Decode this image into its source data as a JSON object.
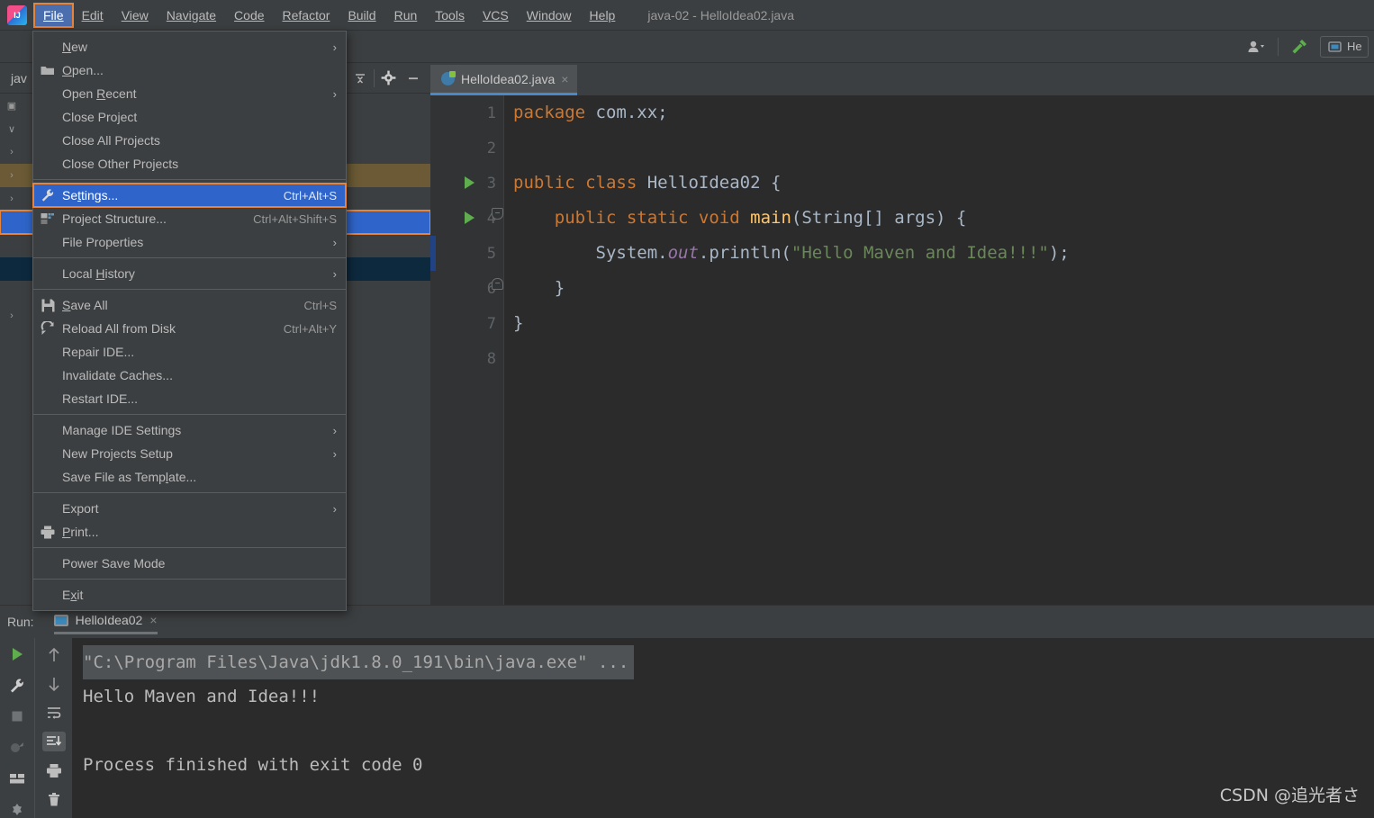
{
  "window": {
    "title": "java-02 - HelloIdea02.java"
  },
  "menubar": {
    "items": [
      {
        "label": "File",
        "mnemonic": "F",
        "active": true
      },
      {
        "label": "Edit",
        "mnemonic": "E",
        "active": false
      },
      {
        "label": "View",
        "mnemonic": "V",
        "active": false
      },
      {
        "label": "Navigate",
        "mnemonic": "N",
        "active": false
      },
      {
        "label": "Code",
        "mnemonic": "C",
        "active": false
      },
      {
        "label": "Refactor",
        "mnemonic": "R",
        "active": false
      },
      {
        "label": "Build",
        "mnemonic": "B",
        "active": false
      },
      {
        "label": "Run",
        "mnemonic": "u",
        "active": false
      },
      {
        "label": "Tools",
        "mnemonic": "T",
        "active": false
      },
      {
        "label": "VCS",
        "mnemonic": "S",
        "active": false
      },
      {
        "label": "Window",
        "mnemonic": "W",
        "active": false
      },
      {
        "label": "Help",
        "mnemonic": "H",
        "active": false
      }
    ]
  },
  "file_menu": {
    "items": [
      {
        "label": "New",
        "icon": "",
        "shortcut": "",
        "submenu": true,
        "separator_after": false,
        "highlight": false
      },
      {
        "label": "Open...",
        "icon": "folder-icon",
        "shortcut": "",
        "submenu": false,
        "separator_after": false,
        "highlight": false
      },
      {
        "label": "Open Recent",
        "icon": "",
        "shortcut": "",
        "submenu": true,
        "separator_after": false,
        "highlight": false
      },
      {
        "label": "Close Project",
        "icon": "",
        "shortcut": "",
        "submenu": false,
        "separator_after": false,
        "highlight": false
      },
      {
        "label": "Close All Projects",
        "icon": "",
        "shortcut": "",
        "submenu": false,
        "separator_after": false,
        "highlight": false
      },
      {
        "label": "Close Other Projects",
        "icon": "",
        "shortcut": "",
        "submenu": false,
        "separator_after": true,
        "highlight": false
      },
      {
        "label": "Settings...",
        "icon": "wrench-icon",
        "shortcut": "Ctrl+Alt+S",
        "submenu": false,
        "separator_after": false,
        "highlight": true
      },
      {
        "label": "Project Structure...",
        "icon": "module-icon",
        "shortcut": "Ctrl+Alt+Shift+S",
        "submenu": false,
        "separator_after": false,
        "highlight": false
      },
      {
        "label": "File Properties",
        "icon": "",
        "shortcut": "",
        "submenu": true,
        "separator_after": true,
        "highlight": false
      },
      {
        "label": "Local History",
        "icon": "",
        "shortcut": "",
        "submenu": true,
        "separator_after": true,
        "highlight": false
      },
      {
        "label": "Save All",
        "icon": "save-icon",
        "shortcut": "Ctrl+S",
        "submenu": false,
        "separator_after": false,
        "highlight": false
      },
      {
        "label": "Reload All from Disk",
        "icon": "reload-icon",
        "shortcut": "Ctrl+Alt+Y",
        "submenu": false,
        "separator_after": false,
        "highlight": false
      },
      {
        "label": "Repair IDE...",
        "icon": "",
        "shortcut": "",
        "submenu": false,
        "separator_after": false,
        "highlight": false
      },
      {
        "label": "Invalidate Caches...",
        "icon": "",
        "shortcut": "",
        "submenu": false,
        "separator_after": false,
        "highlight": false
      },
      {
        "label": "Restart IDE...",
        "icon": "",
        "shortcut": "",
        "submenu": false,
        "separator_after": true,
        "highlight": false
      },
      {
        "label": "Manage IDE Settings",
        "icon": "",
        "shortcut": "",
        "submenu": true,
        "separator_after": false,
        "highlight": false
      },
      {
        "label": "New Projects Setup",
        "icon": "",
        "shortcut": "",
        "submenu": true,
        "separator_after": false,
        "highlight": false
      },
      {
        "label": "Save File as Template...",
        "icon": "",
        "shortcut": "",
        "submenu": false,
        "separator_after": true,
        "highlight": false
      },
      {
        "label": "Export",
        "icon": "",
        "shortcut": "",
        "submenu": true,
        "separator_after": false,
        "highlight": false
      },
      {
        "label": "Print...",
        "icon": "print-icon",
        "shortcut": "",
        "submenu": false,
        "separator_after": true,
        "highlight": false
      },
      {
        "label": "Power Save Mode",
        "icon": "",
        "shortcut": "",
        "submenu": false,
        "separator_after": true,
        "highlight": false
      },
      {
        "label": "Exit",
        "icon": "",
        "shortcut": "",
        "submenu": false,
        "separator_after": false,
        "highlight": false
      }
    ]
  },
  "left_panel": {
    "title": "jav"
  },
  "editor": {
    "tab": {
      "label": "HelloIdea02.java",
      "close": "×"
    },
    "line_numbers": [
      "1",
      "2",
      "3",
      "4",
      "5",
      "6",
      "7",
      "8"
    ],
    "code": [
      {
        "n": "1",
        "text": "package com.xx;"
      },
      {
        "n": "2",
        "text": ""
      },
      {
        "n": "3",
        "text": "public class HelloIdea02 {"
      },
      {
        "n": "4",
        "text": "    public static void main(String[] args) {"
      },
      {
        "n": "5",
        "text": "        System.out.println(\"Hello Maven and Idea!!!\");"
      },
      {
        "n": "6",
        "text": "    }"
      },
      {
        "n": "7",
        "text": "}"
      },
      {
        "n": "8",
        "text": ""
      }
    ]
  },
  "run_panel": {
    "label": "Run:",
    "tab": "HelloIdea02",
    "tab_close": "×",
    "console": [
      "\"C:\\Program Files\\Java\\jdk1.8.0_191\\bin\\java.exe\" ...",
      "Hello Maven and Idea!!!",
      "",
      "Process finished with exit code 0"
    ]
  },
  "toolbar_right": {
    "run_config": "He"
  },
  "watermark": "CSDN @追光者さ",
  "colors": {
    "accent_highlight": "#2f65ca",
    "annotation_border": "#e8833a",
    "editor_bg": "#2b2b2b",
    "panel_bg": "#3c3f41",
    "keyword": "#cc7832",
    "string": "#6a8759",
    "method": "#ffc66d",
    "field": "#9876aa",
    "run_green": "#5fad4e"
  }
}
